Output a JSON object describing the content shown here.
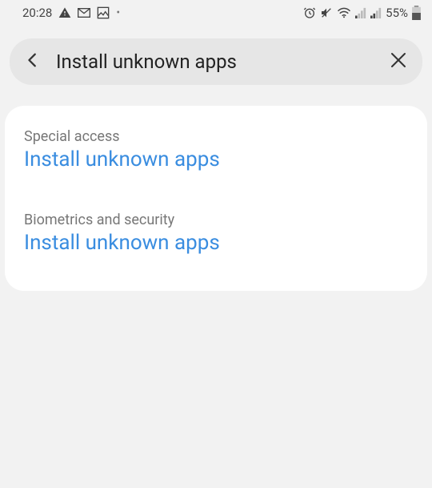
{
  "status": {
    "time": "20:28",
    "battery_text": "55%"
  },
  "search": {
    "query": "Install unknown apps"
  },
  "results": [
    {
      "category": "Special access",
      "title": "Install unknown apps"
    },
    {
      "category": "Biometrics and security",
      "title": "Install unknown apps"
    }
  ]
}
